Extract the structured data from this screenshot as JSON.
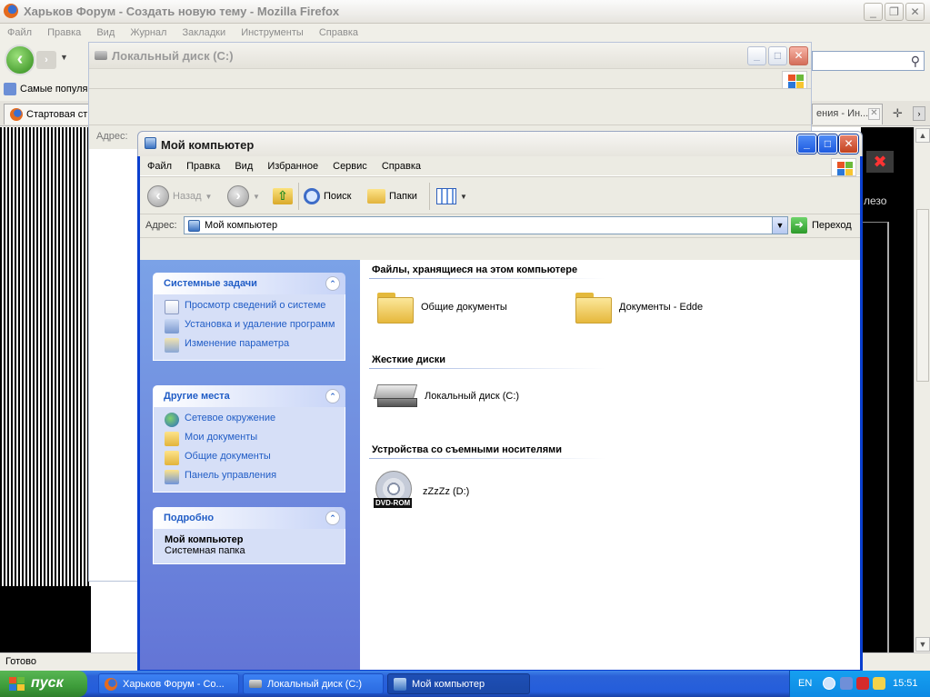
{
  "firefox": {
    "title": "Харьков Форум - Создать новую тему - Mozilla Firefox",
    "menu": [
      "Файл",
      "Правка",
      "Вид",
      "Журнал",
      "Закладки",
      "Инструменты",
      "Справка"
    ],
    "bookmark": "Самые популя",
    "tab1": "Стартовая ст",
    "tab2": "ения - Ин...",
    "side_text": "лезо",
    "status": "Готово"
  },
  "local_disk": {
    "title": "Локальный диск (C:)",
    "address_label": "Адрес:"
  },
  "mycomp": {
    "title": "Мой компьютер",
    "menu": [
      "Файл",
      "Правка",
      "Вид",
      "Избранное",
      "Сервис",
      "Справка"
    ],
    "toolbar": {
      "back": "Назад",
      "search": "Поиск",
      "folders": "Папки"
    },
    "address": {
      "label": "Адрес:",
      "value": "Мой компьютер",
      "go": "Переход"
    },
    "tasks": {
      "title": "Системные задачи",
      "items": [
        "Просмотр сведений о системе",
        "Установка и удаление программ",
        "Изменение параметра"
      ]
    },
    "places": {
      "title": "Другие места",
      "items": [
        "Сетевое окружение",
        "Мои документы",
        "Общие документы",
        "Панель управления"
      ]
    },
    "details": {
      "title": "Подробно",
      "name": "Мой компьютер",
      "type": "Системная папка"
    },
    "sections": {
      "files": "Файлы, хранящиеся на этом компьютере",
      "hdd": "Жесткие диски",
      "removable": "Устройства со съемными носителями"
    },
    "items": {
      "shared_docs": "Общие документы",
      "edde_docs": "Документы - Edde",
      "local_disk": "Локальный диск (C:)",
      "dvd": "zZzZz (D:)",
      "dvd_label": "DVD-ROM"
    }
  },
  "taskbar": {
    "start": "пуск",
    "tasks": [
      "Харьков Форум - Со...",
      "Локальный диск (C:)",
      "Мой компьютер"
    ],
    "lang": "EN",
    "clock": "15:51"
  }
}
